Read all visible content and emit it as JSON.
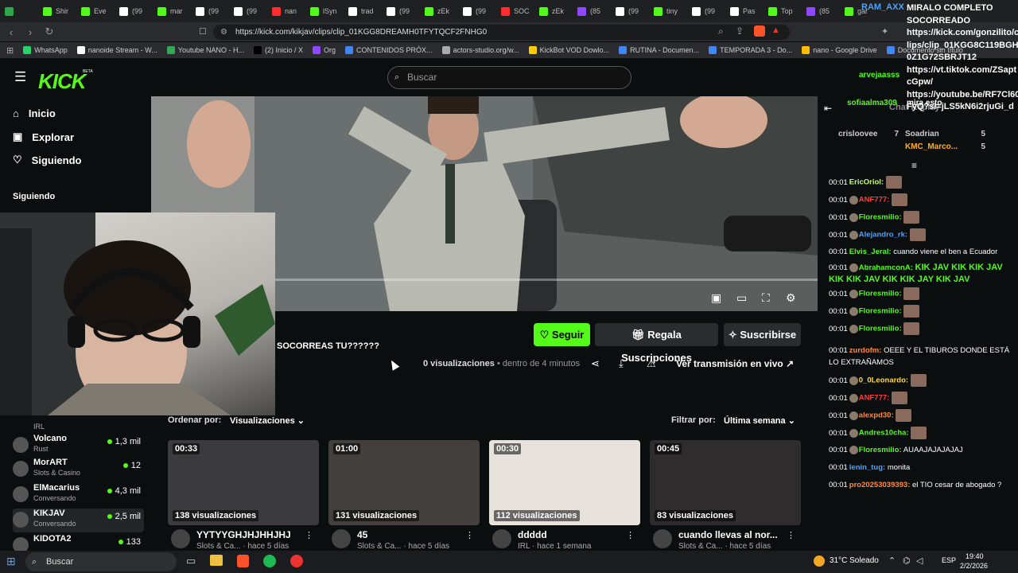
{
  "tabs": [
    {
      "label": "",
      "color": "#2aa84a"
    },
    {
      "label": "Shir",
      "color": "#53fc18"
    },
    {
      "label": "Eve",
      "color": "#53fc18"
    },
    {
      "label": "(99",
      "color": "#ffffff"
    },
    {
      "label": "mar",
      "color": "#53fc18"
    },
    {
      "label": "(99",
      "color": "#ffffff"
    },
    {
      "label": "(99",
      "color": "#ffffff"
    },
    {
      "label": "nan",
      "color": "#ff2d2d"
    },
    {
      "label": "lSyn",
      "color": "#53fc18"
    },
    {
      "label": "trad",
      "color": "#ffffff"
    },
    {
      "label": "(99",
      "color": "#ffffff"
    },
    {
      "label": "zEk",
      "color": "#53fc18"
    },
    {
      "label": "(99",
      "color": "#ffffff"
    },
    {
      "label": "SOC",
      "color": "#ff2d2d"
    },
    {
      "label": "zEk",
      "color": "#53fc18"
    },
    {
      "label": "(85",
      "color": "#9146ff"
    },
    {
      "label": "(99",
      "color": "#ffffff"
    },
    {
      "label": "tiny",
      "color": "#53fc18"
    },
    {
      "label": "(99",
      "color": "#ffffff"
    },
    {
      "label": "Pas",
      "color": "#ffffff"
    },
    {
      "label": "Top",
      "color": "#53fc18"
    },
    {
      "label": "(85",
      "color": "#9146ff"
    },
    {
      "label": "gar",
      "color": "#53fc18"
    }
  ],
  "browser": {
    "url": "https://kick.com/kikjav/clips/clip_01KGG8DREAMH0TFYTQCF2FNHG0"
  },
  "bookmarks": [
    {
      "label": "WhatsApp",
      "color": "#25d366"
    },
    {
      "label": "nanoide Stream - W...",
      "color": "#ffffff"
    },
    {
      "label": "Youtube NANO - H...",
      "color": "#34a853"
    },
    {
      "label": "(2) Inicio / X",
      "color": "#000000"
    },
    {
      "label": "Org",
      "color": "#9146ff"
    },
    {
      "label": "CONTENIDOS PRÓX...",
      "color": "#4285f4"
    },
    {
      "label": "actors-studio.org/w...",
      "color": "#aaaaaa"
    },
    {
      "label": "KickBot VOD Dowlo...",
      "color": "#ffcc00"
    },
    {
      "label": "RUTINA - Documen...",
      "color": "#4285f4"
    },
    {
      "label": "TEMPORADA 3 - Do...",
      "color": "#4285f4"
    },
    {
      "label": "nano - Google Drive",
      "color": "#fbbc04"
    },
    {
      "label": "Documento sin título",
      "color": "#4285f4"
    }
  ],
  "kick": {
    "logo": "KICK",
    "logo_sup": "BETA",
    "search_placeholder": "Buscar"
  },
  "nav": {
    "inicio": "Inicio",
    "explorar": "Explorar",
    "siguiendo": "Siguiendo",
    "section": "Siguiendo"
  },
  "following": [
    {
      "name": "Volcano",
      "category": "Rust",
      "viewers": "1,3 mil"
    },
    {
      "name": "MorART",
      "category": "Slots & Casino",
      "viewers": "12"
    },
    {
      "name": "ElMacarius",
      "category": "Conversando",
      "viewers": "4,3 mil"
    },
    {
      "name": "KIKJAV",
      "category": "Conversando",
      "viewers": "2,5 mil"
    },
    {
      "name": "KIDOTA2",
      "category": "",
      "viewers": "133"
    }
  ],
  "partial_category": "IRL",
  "clip": {
    "title": "SOCORREAS TU??????",
    "views": "0 visualizaciones",
    "meta": " • dentro de 4 minutos",
    "follow": "Seguir",
    "gift": "Regala Suscripciones",
    "subscribe": "Suscribirse",
    "watch_live": "Ver transmisión en vivo"
  },
  "filters": {
    "sort_label": "Ordenar por:",
    "sort_value": "Visualizaciones",
    "filter_label": "Filtrar por:",
    "filter_value": "Última semana"
  },
  "clips": [
    {
      "duration": "00:33",
      "views": "138 visualizaciones",
      "title": "YYTYYGHJHJHHJHJ",
      "meta": "Slots & Ca... · hace 5 días"
    },
    {
      "duration": "01:00",
      "views": "131 visualizaciones",
      "title": "45",
      "meta": "Slots & Ca... · hace 5 días"
    },
    {
      "duration": "00:30",
      "views": "112 visualizaciones",
      "title": "ddddd",
      "meta": "IRL · hace 1 semana"
    },
    {
      "duration": "00:45",
      "views": "83 visualizaciones",
      "title": "cuando llevas al nor...",
      "meta": "Slots & Ca... · hace 5 días"
    }
  ],
  "overlay": {
    "user": "RAM_AXX",
    "lines": [
      "MIRALO COMPLETO",
      "SOCORREADO",
      "https://kick.com/gonzilito/c",
      "lips/clip_01KGG8C119BGH",
      "0Z1G72SBRJT12",
      "https://vt.tiktok.com/ZSapt",
      "cGpw/",
      "https://youtube.be/RF7Cl60D",
      "FyQ?si=jLS5kN6i2rjuGi_d"
    ],
    "chat_replay": "Chat Replay",
    "arvej": "arvejaasss",
    "sofia": "sofiaalma309",
    "mira": "mira esto"
  },
  "top_chatters": [
    {
      "name": "crisloovee",
      "count": "7"
    },
    {
      "name": "Soadrian",
      "count": "5"
    },
    {
      "name": "KMC_Marco...",
      "count": "5"
    }
  ],
  "chat": [
    {
      "time": "00:01",
      "user": "EricOriol:",
      "color": "#c8ff6e",
      "text": ""
    },
    {
      "time": "00:01",
      "user": "ANF777:",
      "color": "#ff3b3b",
      "text": ""
    },
    {
      "time": "00:01",
      "user": "Floresmilio:",
      "color": "#53fc18",
      "text": ""
    },
    {
      "time": "00:01",
      "user": "Alejandro_rk:",
      "color": "#4aa3ff",
      "text": ""
    },
    {
      "time": "00:01",
      "user": "Elvis_Jeral:",
      "color": "#53fc18",
      "text": "cuando viene el ben a Ecuador"
    },
    {
      "time": "00:01",
      "user": "AbrahamconA:",
      "color": "#53fc18",
      "text": "KIK JAV KIK KIK JAV KIK KIK JAV KIK KIK JAY KIK JAV"
    },
    {
      "time": "00:01",
      "user": "Floresmilio:",
      "color": "#53fc18",
      "text": ""
    },
    {
      "time": "00:01",
      "user": "Floresmilio:",
      "color": "#53fc18",
      "text": ""
    },
    {
      "time": "00:01",
      "user": "Floresmilio:",
      "color": "#53fc18",
      "text": ""
    },
    {
      "time": "00:01",
      "user": "zurdofm:",
      "color": "#ff8a3d",
      "text": "OEEE Y EL TIBUROS DONDE ESTÁ LO EXTRAÑAMOS"
    },
    {
      "time": "00:01",
      "user": "0_0Leonardo:",
      "color": "#ffd93b",
      "text": ""
    },
    {
      "time": "00:01",
      "user": "ANF777:",
      "color": "#ff3b3b",
      "text": ""
    },
    {
      "time": "00:01",
      "user": "alexpd30:",
      "color": "#ff8a3d",
      "text": ""
    },
    {
      "time": "00:01",
      "user": "Andres10cha:",
      "color": "#53fc18",
      "text": ""
    },
    {
      "time": "00:01",
      "user": "Floresmilio:",
      "color": "#53fc18",
      "text": "AUAAJAJAJAJAJ"
    },
    {
      "time": "00:01",
      "user": "lenin_tug:",
      "color": "#4aa3ff",
      "text": "monita"
    },
    {
      "time": "00:01",
      "user": "pro20253039393:",
      "color": "#ff8a3d",
      "text": "el TIO cesar de abogado ?"
    }
  ],
  "taskbar": {
    "search": "Buscar",
    "weather": "31°C  Soleado",
    "lang": "ESP",
    "time": "19:40",
    "date": "2/2/2026"
  }
}
